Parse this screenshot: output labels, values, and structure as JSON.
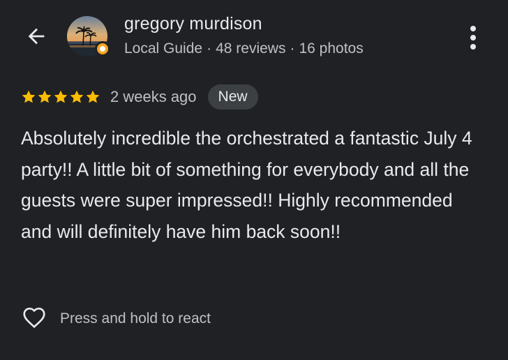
{
  "header": {
    "back_icon": "arrow-back-icon",
    "reviewer_name": "gregory murdison",
    "guide_label": "Local Guide",
    "separator": "·",
    "reviews_count": "48 reviews",
    "photos_count": "16 photos",
    "more_icon": "more-vertical-icon"
  },
  "rating": {
    "stars": 5,
    "star_color": "#fbbc04",
    "time_ago": "2 weeks ago",
    "badge": "New"
  },
  "review": {
    "text": "Absolutely incredible the orchestrated a fantastic July 4 party!! A little bit of something for everybody and all the guests were super impressed!! Highly recommended and will definitely have him back soon!!"
  },
  "reactions": {
    "heart_icon": "heart-outline-icon",
    "prompt": "Press and hold to react"
  },
  "colors": {
    "background": "#202124",
    "primary_text": "#e8eaed",
    "secondary_text": "#bdc1c6",
    "badge_background": "#3c4043",
    "local_guide_badge": "#f6a623"
  }
}
